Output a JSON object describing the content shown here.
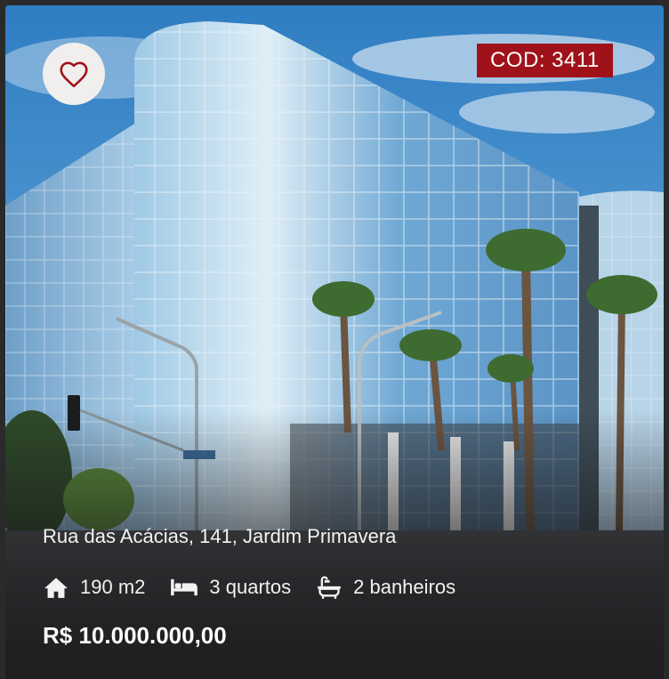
{
  "listing": {
    "code_label": "COD: 3411",
    "address": "Rua das Acácias, 141, Jardim Primavera",
    "features": {
      "area": "190 m2",
      "bedrooms": "3 quartos",
      "bathrooms": "2 banheiros"
    },
    "price": "R$ 10.000.000,00"
  },
  "icons": {
    "favorite": "heart-outline-icon",
    "area": "home-icon",
    "bedrooms": "bed-icon",
    "bathrooms": "bathtub-icon"
  },
  "colors": {
    "code_badge": "#a0121a",
    "heart": "#a0121a"
  }
}
